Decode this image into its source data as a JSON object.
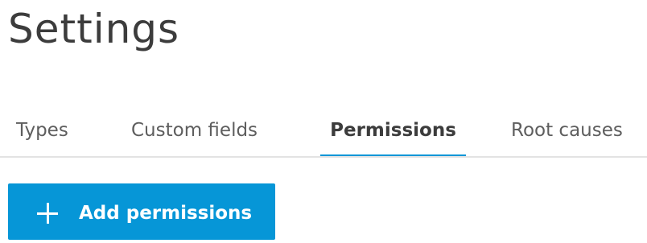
{
  "page": {
    "title": "Settings"
  },
  "tabs": [
    {
      "label": "Types",
      "active": false
    },
    {
      "label": "Custom fields",
      "active": false
    },
    {
      "label": "Permissions",
      "active": true
    },
    {
      "label": "Root causes",
      "active": false
    }
  ],
  "actions": {
    "add_button_label": "Add permissions",
    "add_button_icon": "plus-icon"
  },
  "colors": {
    "accent": "#0696d7",
    "text": "#3c3c3c",
    "tab_text": "#5e5e5e",
    "divider": "#e3e3e3"
  }
}
